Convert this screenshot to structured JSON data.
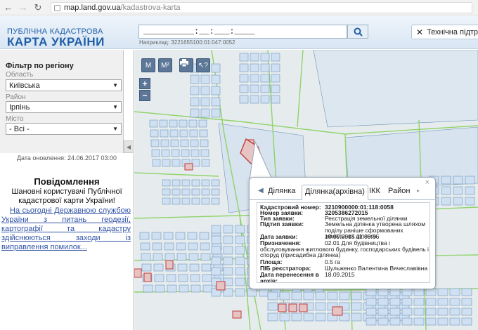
{
  "browser": {
    "url_host": "map.land.gov.ua",
    "url_path": "/kadastrova-karta"
  },
  "header": {
    "brand_line1": "ПУБЛІЧНА КАДАСТРОВА",
    "brand_line2": "КАРТА УКРАЇНИ",
    "search_value": "__________:__:___:____",
    "search_hint": "Наприклад: 3221655100:01:047:0052",
    "support_label": "Технічна підтримка"
  },
  "sidebar": {
    "filter_title": "Фільтр по регіону",
    "oblast_label": "Область",
    "oblast_value": "Київська",
    "raion_label": "Район",
    "raion_value": "Ірпінь",
    "misto_label": "Місто",
    "misto_value": "- Всі -",
    "updated": "Дата оновлення: 24.06.2017 03:00",
    "notice_title": "Повідомлення",
    "notice_text": "Шановні користувачі Публічної кадастрової карти України!",
    "notice_link": "На сьогодні Державною службою України з питань геодезії, картографії та кадастру здійснюються заходи із виправлення помилок..."
  },
  "map_tools": {
    "measure_label": "M",
    "measure_area_label": "M²",
    "zoom_in": "+",
    "zoom_out": "−"
  },
  "popup": {
    "tabs": [
      "Ділянка",
      "Ділянка(архівна)",
      "ІКК",
      "Район"
    ],
    "active_tab": "Ділянка(архівна)",
    "fields": [
      {
        "key": "Кадастровий номер:",
        "value": "3210900000:01:118:0058"
      },
      {
        "key": "Номер заявки:",
        "value": "3205386272015"
      },
      {
        "key": "Тип заявки:",
        "value": "Реєстрація земельної ділянки"
      },
      {
        "key": "Підтип заявки:",
        "value": "Земельна ділянка утворена шляхом поділу раніше сформованих земельних ділянок"
      },
      {
        "key": "Дата заявки:",
        "value": "18.09.2015 11:09:56"
      },
      {
        "key": "Призначення:",
        "value": "02.01 Для будівництва і обслуговування житлового будинку, господарських будівель і споруд (присадибна ділянка)"
      },
      {
        "key": "Площа:",
        "value": "0.5 га"
      },
      {
        "key": "ПІБ реєстратора:",
        "value": "Шульженко Валентина Вячеславівна"
      },
      {
        "key": "Дата перенесення в архів:",
        "value": "18.09.2015"
      }
    ]
  },
  "colors": {
    "brand": "#1f5ea8",
    "tool_bg": "#5c7797",
    "parcel_fill": "#cfe0f2",
    "parcel_stroke": "#6f93b8",
    "selected_fill": "#e7c4c4",
    "selected_stroke": "#c23b3b",
    "road": "#8fd36a"
  }
}
